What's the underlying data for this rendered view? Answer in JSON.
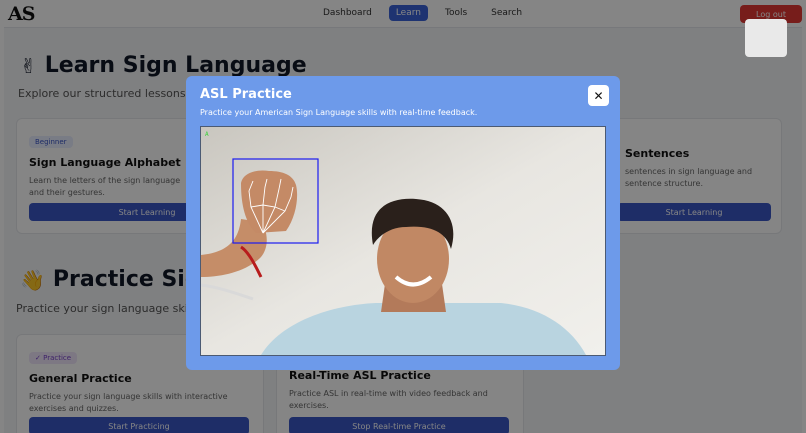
{
  "nav": {
    "logo_text": "AS",
    "logo_subtext": "",
    "links": [
      "Dashboard",
      "Learn",
      "Tools",
      "Search"
    ],
    "active_link": "Learn",
    "logout_label": "Log out"
  },
  "learn_section": {
    "emoji": "✌",
    "title": "Learn Sign Language",
    "subtitle": "Explore our structured lessons to",
    "cards": [
      {
        "badge": "Beginner",
        "title": "Sign Language Alphabet",
        "description": "Learn the letters of the sign language and their gestures.",
        "button": "Start Learning"
      },
      {
        "title": "Sentences",
        "description": "sentences in sign language and sentence structure.",
        "button": "Start Learning"
      }
    ]
  },
  "practice_section": {
    "emoji": "👋",
    "title": "Practice Sign Language",
    "subtitle": "Practice your sign language skills",
    "cards": [
      {
        "badge": "✓ Practice",
        "title": "General Practice",
        "description": "Practice your sign language skills with interactive exercises and quizzes.",
        "button": "Start Practicing"
      },
      {
        "title": "Real-Time ASL Practice",
        "description": "Practice ASL in real-time with video feedback and exercises.",
        "button": "Stop Real-time Practice"
      }
    ]
  },
  "modal": {
    "title": "ASL Practice",
    "subtitle": "Practice your American Sign Language skills with real-time feedback.",
    "close_icon": "close-icon",
    "overlay_text": "A",
    "video": {
      "bbox_color": "#1c1cf0",
      "landmark_color": "#ffffff"
    }
  },
  "colors": {
    "accent": "#3a56c5",
    "nav_active": "#3a63d8",
    "logout": "#e53935",
    "modal_bg": "#6d9aea"
  }
}
